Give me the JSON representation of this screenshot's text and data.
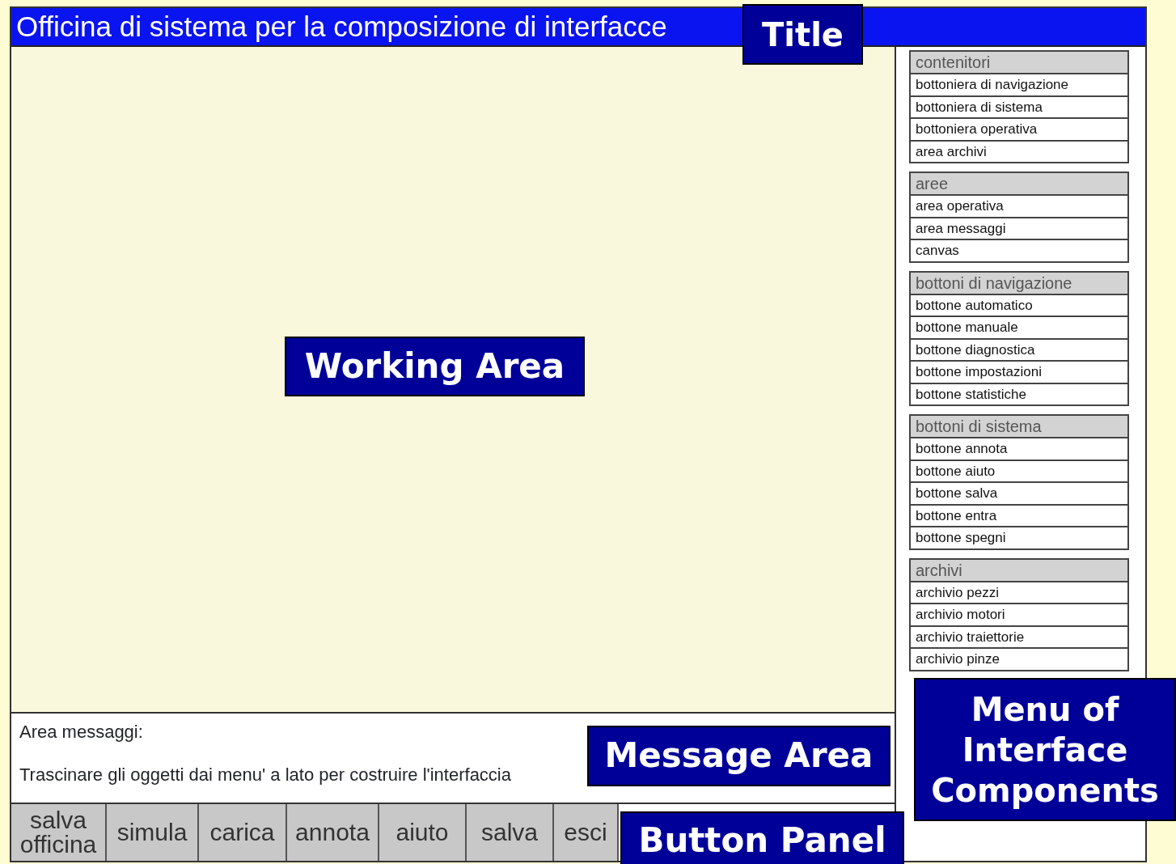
{
  "window": {
    "title": "Officina di sistema per la composizione di interfacce"
  },
  "messages": {
    "label": "Area messaggi:",
    "text": "Trascinare gli oggetti dai menu' a lato per costruire l'interfaccia"
  },
  "buttons": [
    "salva officina",
    "simula",
    "carica",
    "annota",
    "aiuto",
    "salva",
    "esci"
  ],
  "menu": {
    "groups": [
      {
        "title": "contenitori",
        "items": [
          "bottoniera di navigazione",
          "bottoniera di sistema",
          "bottoniera operativa",
          "area archivi"
        ]
      },
      {
        "title": "aree",
        "items": [
          "area operativa",
          "area messaggi",
          "canvas"
        ]
      },
      {
        "title": "bottoni di navigazione",
        "items": [
          "bottone automatico",
          "bottone manuale",
          "bottone diagnostica",
          "bottone impostazioni",
          "bottone statistiche"
        ]
      },
      {
        "title": "bottoni di sistema",
        "items": [
          "bottone annota",
          "bottone aiuto",
          "bottone salva",
          "bottone entra",
          "bottone spegni"
        ]
      },
      {
        "title": "archivi",
        "items": [
          "archivio pezzi",
          "archivio motori",
          "archivio traiettorie",
          "archivio pinze"
        ]
      }
    ]
  },
  "callouts": [
    {
      "kind": "title",
      "text": "Title"
    },
    {
      "kind": "working",
      "text": "Working Area"
    },
    {
      "kind": "message",
      "text": "Message Area"
    },
    {
      "kind": "buttons",
      "text": "Button Panel"
    },
    {
      "kind": "menu",
      "text": "Menu of Interface Components"
    }
  ]
}
